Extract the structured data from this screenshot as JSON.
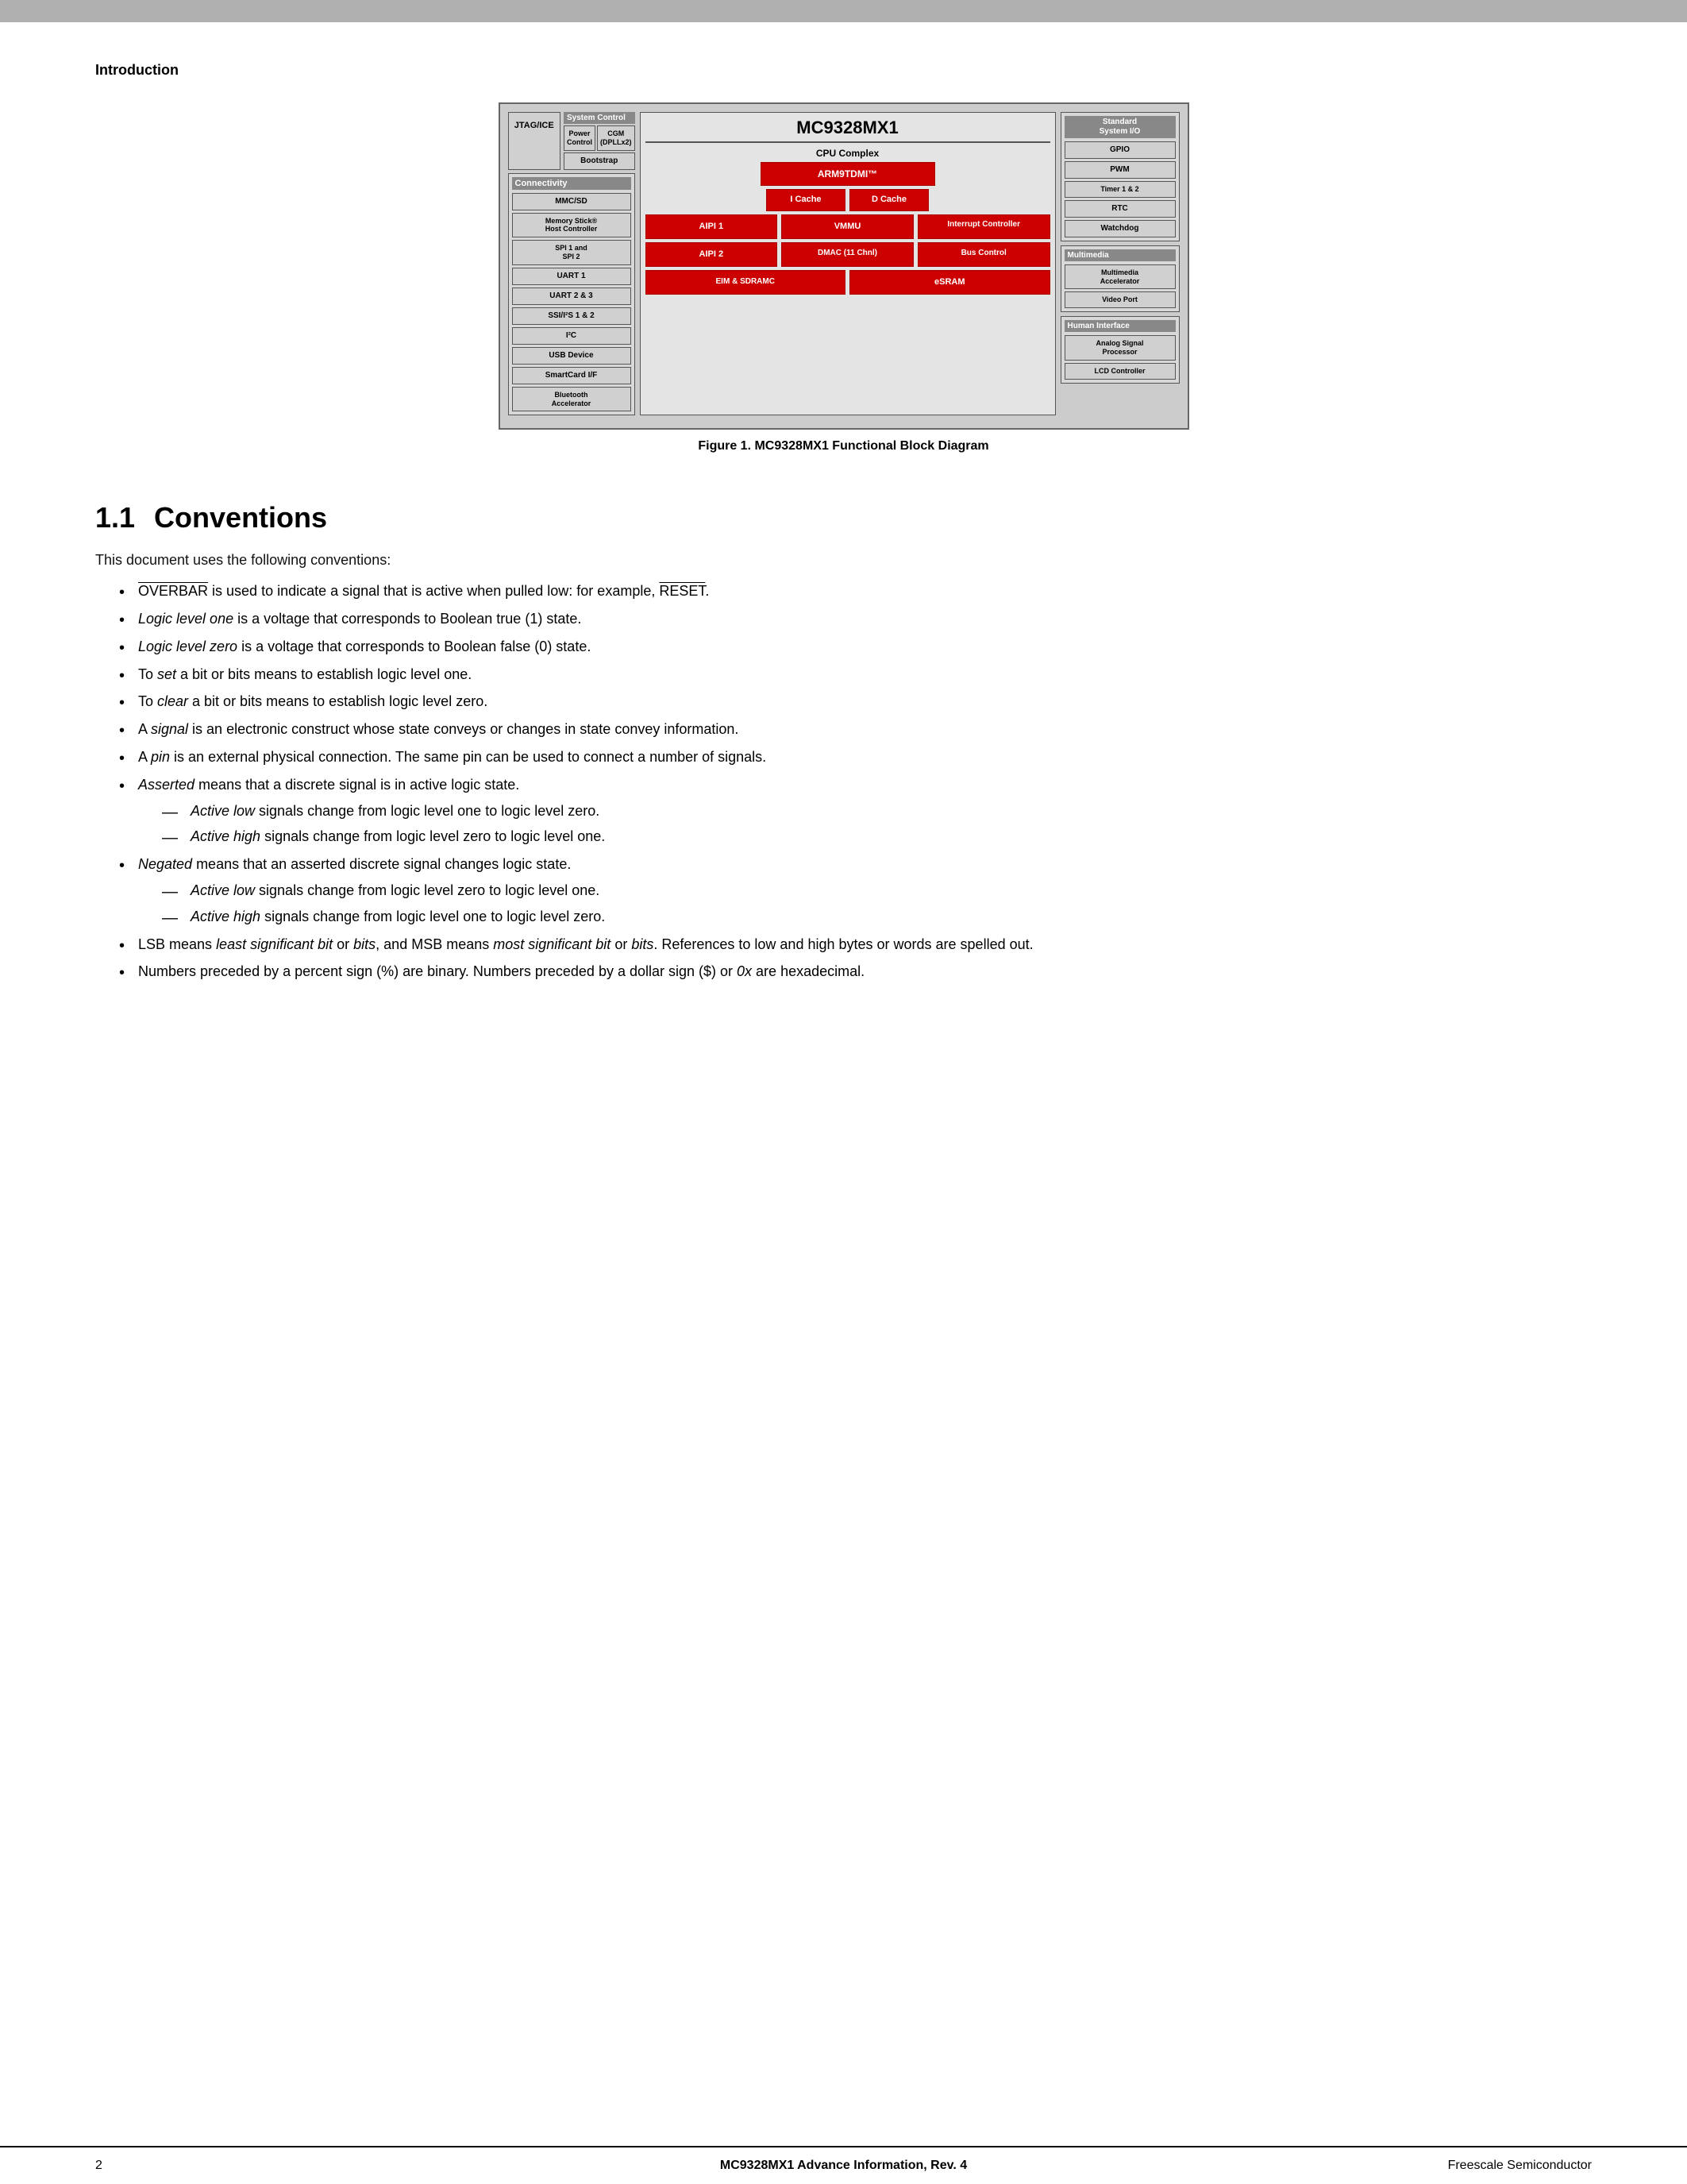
{
  "page": {
    "top_section_label": "Introduction",
    "figure_caption": "Figure 1.   MC9328MX1 Functional Block Diagram",
    "footer_doc": "MC9328MX1 Advance Information, Rev. 4",
    "footer_page": "2",
    "footer_company": "Freescale Semiconductor"
  },
  "block_diagram": {
    "chip_name": "MC9328MX1",
    "jtag": "JTAG/ICE",
    "system_control": {
      "label": "System Control",
      "bootstrap": "Bootstrap",
      "power_control": "Power Control",
      "cgm": "CGM (DPLLx2)"
    },
    "connectivity": {
      "header": "Connectivity",
      "items": [
        "MMC/SD",
        "Memory Stick® Host Controller",
        "SPI 1 and SPI 2",
        "UART 1",
        "UART 2 & 3",
        "SSI/I²S 1 & 2",
        "I²C",
        "USB Device",
        "SmartCard I/F",
        "Bluetooth Accelerator"
      ]
    },
    "cpu_complex": {
      "label": "CPU Complex",
      "arm": "ARM9TDMI™",
      "icache": "I Cache",
      "dcache": "D Cache",
      "aipi1": "AIPI 1",
      "vmmu": "VMMU",
      "interrupt": "Interrupt Controller",
      "aipi2": "AIPI 2",
      "dmac": "DMAC (11 Chnl)",
      "bus_control": "Bus Control",
      "eim": "EIM & SDRAMC",
      "esram": "eSRAM"
    },
    "standard_io": {
      "header": "Standard System I/O",
      "items": [
        "GPIO",
        "PWM",
        "Timer 1 & 2",
        "RTC",
        "Watchdog"
      ]
    },
    "multimedia": {
      "header": "Multimedia",
      "items": [
        "Multimedia Accelerator",
        "Video Port"
      ]
    },
    "human_interface": {
      "header": "Human Interface",
      "items": [
        "Analog Signal Processor",
        "LCD Controller"
      ]
    }
  },
  "section_1_1": {
    "title": "1.1",
    "title_text": "Conventions",
    "intro": "This document uses the following conventions:",
    "bullets": [
      {
        "text_parts": [
          {
            "type": "overbar",
            "text": "OVERBAR"
          },
          {
            "type": "normal",
            "text": " is used to indicate a signal that is active when pulled low: for example, "
          },
          {
            "type": "overbar",
            "text": "RESET"
          },
          {
            "type": "normal",
            "text": "."
          }
        ]
      },
      {
        "text_parts": [
          {
            "type": "italic",
            "text": "Logic level one"
          },
          {
            "type": "normal",
            "text": " is a voltage that corresponds to Boolean true (1) state."
          }
        ]
      },
      {
        "text_parts": [
          {
            "type": "italic",
            "text": "Logic level zero"
          },
          {
            "type": "normal",
            "text": " is a voltage that corresponds to Boolean false (0) state."
          }
        ]
      },
      {
        "text_parts": [
          {
            "type": "normal",
            "text": "To "
          },
          {
            "type": "italic",
            "text": "set"
          },
          {
            "type": "normal",
            "text": " a bit or bits means to establish logic level one."
          }
        ]
      },
      {
        "text_parts": [
          {
            "type": "normal",
            "text": "To "
          },
          {
            "type": "italic",
            "text": "clear"
          },
          {
            "type": "normal",
            "text": " a bit or bits means to establish logic level zero."
          }
        ]
      },
      {
        "text_parts": [
          {
            "type": "normal",
            "text": "A "
          },
          {
            "type": "italic",
            "text": "signal"
          },
          {
            "type": "normal",
            "text": " is an electronic construct whose state conveys or changes in state convey information."
          }
        ]
      },
      {
        "text_parts": [
          {
            "type": "normal",
            "text": "A "
          },
          {
            "type": "italic",
            "text": "pin"
          },
          {
            "type": "normal",
            "text": " is an external physical connection. The same pin can be used to connect a number of signals."
          }
        ]
      },
      {
        "text_parts": [
          {
            "type": "italic",
            "text": "Asserted"
          },
          {
            "type": "normal",
            "text": " means that a discrete signal is in active logic state."
          }
        ],
        "sub_items": [
          {
            "text_parts": [
              {
                "type": "italic",
                "text": "Active low"
              },
              {
                "type": "normal",
                "text": " signals change from logic level one to logic level zero."
              }
            ]
          },
          {
            "text_parts": [
              {
                "type": "italic",
                "text": "Active high"
              },
              {
                "type": "normal",
                "text": " signals change from logic level zero to logic level one."
              }
            ]
          }
        ]
      },
      {
        "text_parts": [
          {
            "type": "italic",
            "text": "Negated"
          },
          {
            "type": "normal",
            "text": " means that an asserted discrete signal changes logic state."
          }
        ],
        "sub_items": [
          {
            "text_parts": [
              {
                "type": "italic",
                "text": "Active low"
              },
              {
                "type": "normal",
                "text": " signals change from logic level zero to logic level one."
              }
            ]
          },
          {
            "text_parts": [
              {
                "type": "italic",
                "text": "Active high"
              },
              {
                "type": "normal",
                "text": " signals change from logic level one to logic level zero."
              }
            ]
          }
        ]
      },
      {
        "text_parts": [
          {
            "type": "normal",
            "text": "LSB means "
          },
          {
            "type": "italic",
            "text": "least significant bit"
          },
          {
            "type": "normal",
            "text": " or "
          },
          {
            "type": "italic",
            "text": "bits"
          },
          {
            "type": "normal",
            "text": ", and MSB means "
          },
          {
            "type": "italic",
            "text": "most significant bit"
          },
          {
            "type": "normal",
            "text": " or "
          },
          {
            "type": "italic",
            "text": "bits"
          },
          {
            "type": "normal",
            "text": ". References to low and high bytes or words are spelled out."
          }
        ]
      },
      {
        "text_parts": [
          {
            "type": "normal",
            "text": "Numbers preceded by a percent sign (%) are binary. Numbers preceded by a dollar sign ($) or "
          },
          {
            "type": "italic",
            "text": "0x"
          },
          {
            "type": "normal",
            "text": " are hexadecimal."
          }
        ]
      }
    ]
  }
}
